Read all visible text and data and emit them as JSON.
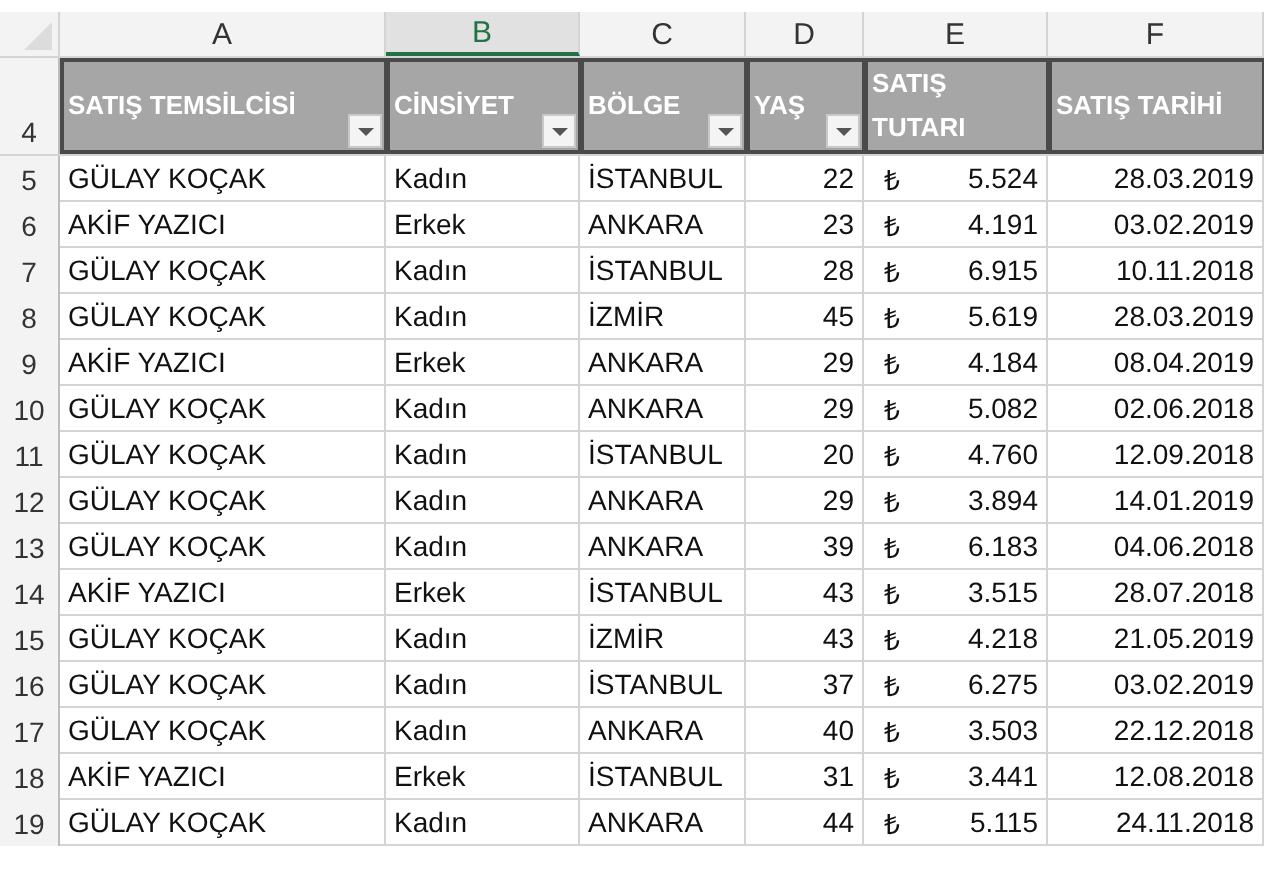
{
  "columns": [
    {
      "letter": "A",
      "selected": false
    },
    {
      "letter": "B",
      "selected": true
    },
    {
      "letter": "C",
      "selected": false
    },
    {
      "letter": "D",
      "selected": false
    },
    {
      "letter": "E",
      "selected": false
    },
    {
      "letter": "F",
      "selected": false
    }
  ],
  "header_row": {
    "number": "4",
    "cells": [
      {
        "label": "SATIŞ TEMSİLCİSİ",
        "filter": true
      },
      {
        "label": "CİNSİYET",
        "filter": true
      },
      {
        "label": "BÖLGE",
        "filter": true
      },
      {
        "label": "YAŞ",
        "filter": true
      },
      {
        "label": "SATIŞ TUTARI",
        "filter": false
      },
      {
        "label": "SATIŞ TARİHİ",
        "filter": false
      }
    ]
  },
  "rows": [
    {
      "number": "5",
      "representative": "GÜLAY KOÇAK",
      "gender": "Kadın",
      "region": "İSTANBUL",
      "age": "22",
      "currency": "₺",
      "amount": "5.524",
      "date": "28.03.2019"
    },
    {
      "number": "6",
      "representative": "AKİF YAZICI",
      "gender": "Erkek",
      "region": "ANKARA",
      "age": "23",
      "currency": "₺",
      "amount": "4.191",
      "date": "03.02.2019"
    },
    {
      "number": "7",
      "representative": "GÜLAY KOÇAK",
      "gender": "Kadın",
      "region": "İSTANBUL",
      "age": "28",
      "currency": "₺",
      "amount": "6.915",
      "date": "10.11.2018"
    },
    {
      "number": "8",
      "representative": "GÜLAY KOÇAK",
      "gender": "Kadın",
      "region": "İZMİR",
      "age": "45",
      "currency": "₺",
      "amount": "5.619",
      "date": "28.03.2019"
    },
    {
      "number": "9",
      "representative": "AKİF YAZICI",
      "gender": "Erkek",
      "region": "ANKARA",
      "age": "29",
      "currency": "₺",
      "amount": "4.184",
      "date": "08.04.2019"
    },
    {
      "number": "10",
      "representative": "GÜLAY KOÇAK",
      "gender": "Kadın",
      "region": "ANKARA",
      "age": "29",
      "currency": "₺",
      "amount": "5.082",
      "date": "02.06.2018"
    },
    {
      "number": "11",
      "representative": "GÜLAY KOÇAK",
      "gender": "Kadın",
      "region": "İSTANBUL",
      "age": "20",
      "currency": "₺",
      "amount": "4.760",
      "date": "12.09.2018"
    },
    {
      "number": "12",
      "representative": "GÜLAY KOÇAK",
      "gender": "Kadın",
      "region": "ANKARA",
      "age": "29",
      "currency": "₺",
      "amount": "3.894",
      "date": "14.01.2019"
    },
    {
      "number": "13",
      "representative": "GÜLAY KOÇAK",
      "gender": "Kadın",
      "region": "ANKARA",
      "age": "39",
      "currency": "₺",
      "amount": "6.183",
      "date": "04.06.2018"
    },
    {
      "number": "14",
      "representative": "AKİF YAZICI",
      "gender": "Erkek",
      "region": "İSTANBUL",
      "age": "43",
      "currency": "₺",
      "amount": "3.515",
      "date": "28.07.2018"
    },
    {
      "number": "15",
      "representative": "GÜLAY KOÇAK",
      "gender": "Kadın",
      "region": "İZMİR",
      "age": "43",
      "currency": "₺",
      "amount": "4.218",
      "date": "21.05.2019"
    },
    {
      "number": "16",
      "representative": "GÜLAY KOÇAK",
      "gender": "Kadın",
      "region": "İSTANBUL",
      "age": "37",
      "currency": "₺",
      "amount": "6.275",
      "date": "03.02.2019"
    },
    {
      "number": "17",
      "representative": "GÜLAY KOÇAK",
      "gender": "Kadın",
      "region": "ANKARA",
      "age": "40",
      "currency": "₺",
      "amount": "3.503",
      "date": "22.12.2018"
    },
    {
      "number": "18",
      "representative": "AKİF YAZICI",
      "gender": "Erkek",
      "region": "İSTANBUL",
      "age": "31",
      "currency": "₺",
      "amount": "3.441",
      "date": "12.08.2018"
    },
    {
      "number": "19",
      "representative": "GÜLAY KOÇAK",
      "gender": "Kadın",
      "region": "ANKARA",
      "age": "44",
      "currency": "₺",
      "amount": "5.115",
      "date": "24.11.2018"
    }
  ]
}
